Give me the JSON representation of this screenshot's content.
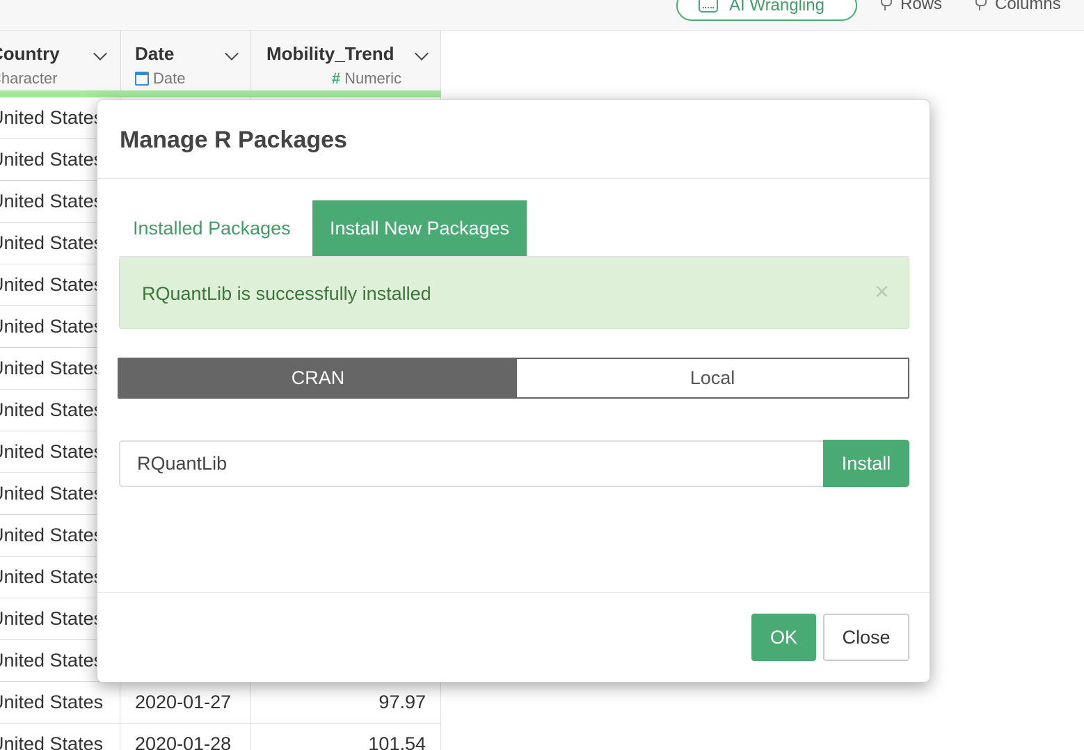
{
  "toolbar": {
    "ai_label": "AI Wrangling",
    "rows_label": "Rows",
    "columns_label": "Columns"
  },
  "columns": [
    {
      "name": "Country",
      "type": "Character"
    },
    {
      "name": "Date",
      "type": "Date"
    },
    {
      "name": "Mobility_Trend",
      "type": "Numeric"
    }
  ],
  "rows": [
    {
      "country": "United States",
      "date": "",
      "value": ""
    },
    {
      "country": "United States",
      "date": "",
      "value": ""
    },
    {
      "country": "United States",
      "date": "",
      "value": ""
    },
    {
      "country": "United States",
      "date": "",
      "value": ""
    },
    {
      "country": "United States",
      "date": "",
      "value": ""
    },
    {
      "country": "United States",
      "date": "",
      "value": ""
    },
    {
      "country": "United States",
      "date": "",
      "value": ""
    },
    {
      "country": "United States",
      "date": "",
      "value": ""
    },
    {
      "country": "United States",
      "date": "",
      "value": ""
    },
    {
      "country": "United States",
      "date": "",
      "value": ""
    },
    {
      "country": "United States",
      "date": "",
      "value": ""
    },
    {
      "country": "United States",
      "date": "",
      "value": ""
    },
    {
      "country": "United States",
      "date": "",
      "value": ""
    },
    {
      "country": "United States",
      "date": "",
      "value": ""
    },
    {
      "country": "United States",
      "date": "2020-01-27",
      "value": "97.97"
    },
    {
      "country": "United States",
      "date": "2020-01-28",
      "value": "101.54"
    }
  ],
  "modal": {
    "title": "Manage R Packages",
    "tabs": [
      {
        "label": "Installed Packages",
        "active": false
      },
      {
        "label": "Install New Packages",
        "active": true
      }
    ],
    "alert": {
      "message": "RQuantLib is successfully installed",
      "close": "×"
    },
    "source": {
      "options": [
        "CRAN",
        "Local"
      ],
      "selected": "CRAN"
    },
    "package_input": {
      "value": "RQuantLib"
    },
    "install_label": "Install",
    "ok_label": "OK",
    "close_label": "Close"
  },
  "colors": {
    "accent": "#4aaa74",
    "alert_bg": "#dff0d8",
    "alert_text": "#3c763d",
    "segment_active": "#666666",
    "type_bar": "#a8e6a0"
  }
}
